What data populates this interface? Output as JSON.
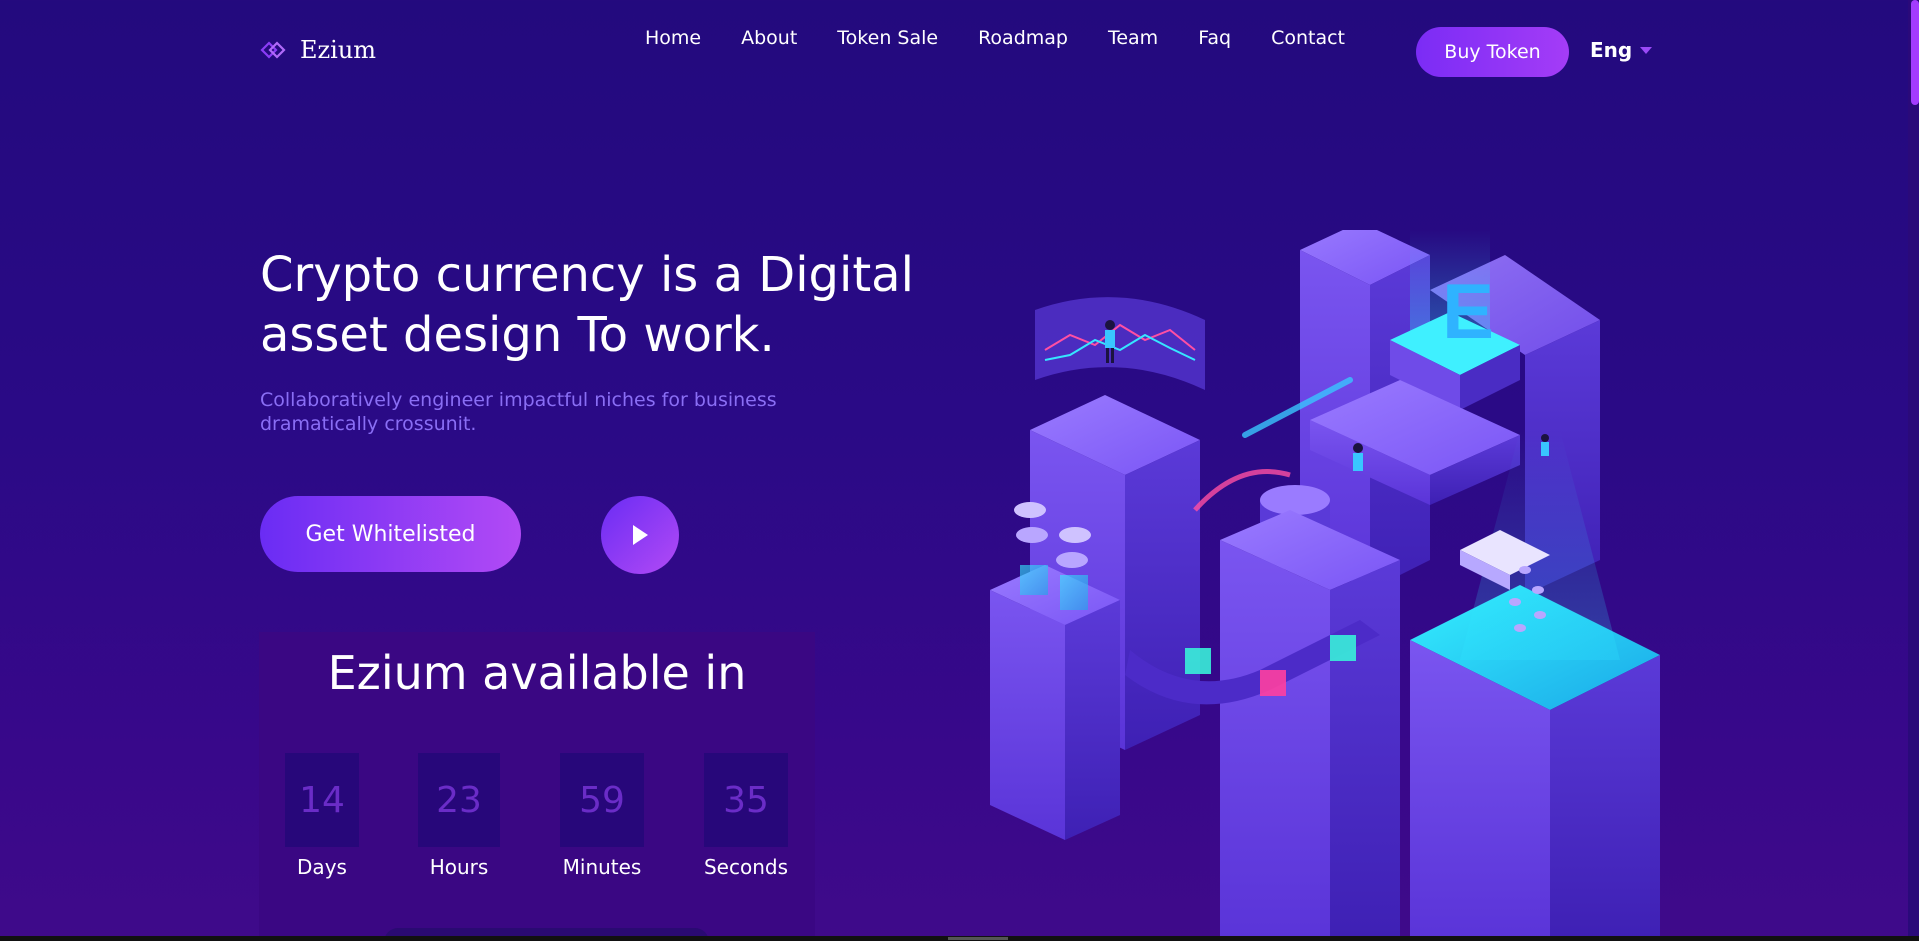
{
  "brand": {
    "name": "Ezium",
    "icon": "diamond-logo-icon"
  },
  "nav": {
    "items": [
      "Home",
      "About",
      "Token Sale",
      "Roadmap",
      "Team",
      "Faq",
      "Contact"
    ],
    "buy_label": "Buy Token",
    "language": "Eng"
  },
  "hero": {
    "title_line1": "Crypto currency is a Digital",
    "title_line2": "asset design To work.",
    "subtitle_line1": "Collaboratively engineer impactful niches for business",
    "subtitle_line2": "dramatically crossunit.",
    "cta_label": "Get Whitelisted",
    "play_icon": "play-icon"
  },
  "countdown": {
    "title": "Ezium available in",
    "days": {
      "value": "14",
      "label": "Days"
    },
    "hours": {
      "value": "23",
      "label": "Hours"
    },
    "minutes": {
      "value": "59",
      "label": "Minutes"
    },
    "seconds": {
      "value": "35",
      "label": "Seconds"
    }
  },
  "illustration": {
    "letter": "E"
  },
  "colors": {
    "background_top": "#230a7e",
    "background_bottom": "#3f0a8a",
    "accent_purple": "#a43cf7",
    "subtitle": "#8a6ef5",
    "panel": "#3a0783",
    "cyan_glow": "#2ee6ff"
  }
}
